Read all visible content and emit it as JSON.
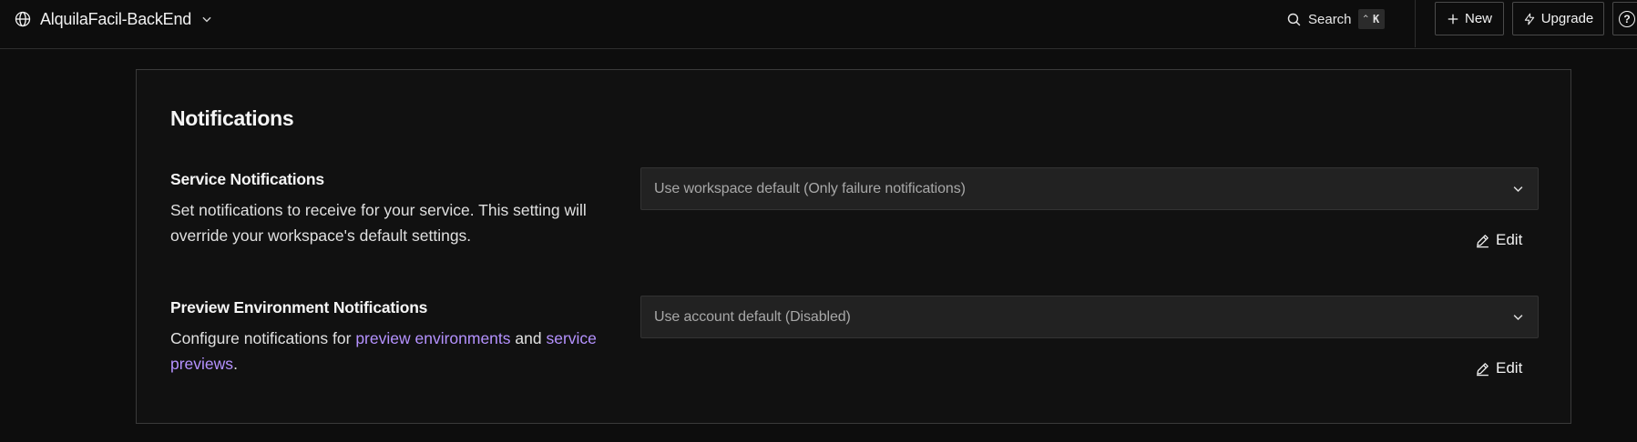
{
  "header": {
    "project_name": "AlquilaFacil-BackEnd",
    "project_icon": "globe-icon",
    "search": {
      "label": "Search",
      "shortcut_key": "K",
      "shortcut_modifier": "^"
    },
    "new_label": "New",
    "upgrade_label": "Upgrade",
    "help_glyph": "?"
  },
  "notifications": {
    "title": "Notifications",
    "service": {
      "title": "Service Notifications",
      "description": "Set notifications to receive for your service. This setting will override your workspace's default settings.",
      "selected": "Use workspace default (Only failure notifications)",
      "edit_label": "Edit"
    },
    "preview": {
      "title": "Preview Environment Notifications",
      "desc_before": "Configure notifications for ",
      "link_preview_environments": "preview environments",
      "desc_middle": " and ",
      "link_service_previews": "service previews",
      "desc_after": ".",
      "selected": "Use account default (Disabled)",
      "edit_label": "Edit"
    }
  },
  "colors": {
    "background": "#0d0d0d",
    "card": "#111111",
    "select": "#222222",
    "link": "#b592ff",
    "border": "#3a3a3a"
  }
}
